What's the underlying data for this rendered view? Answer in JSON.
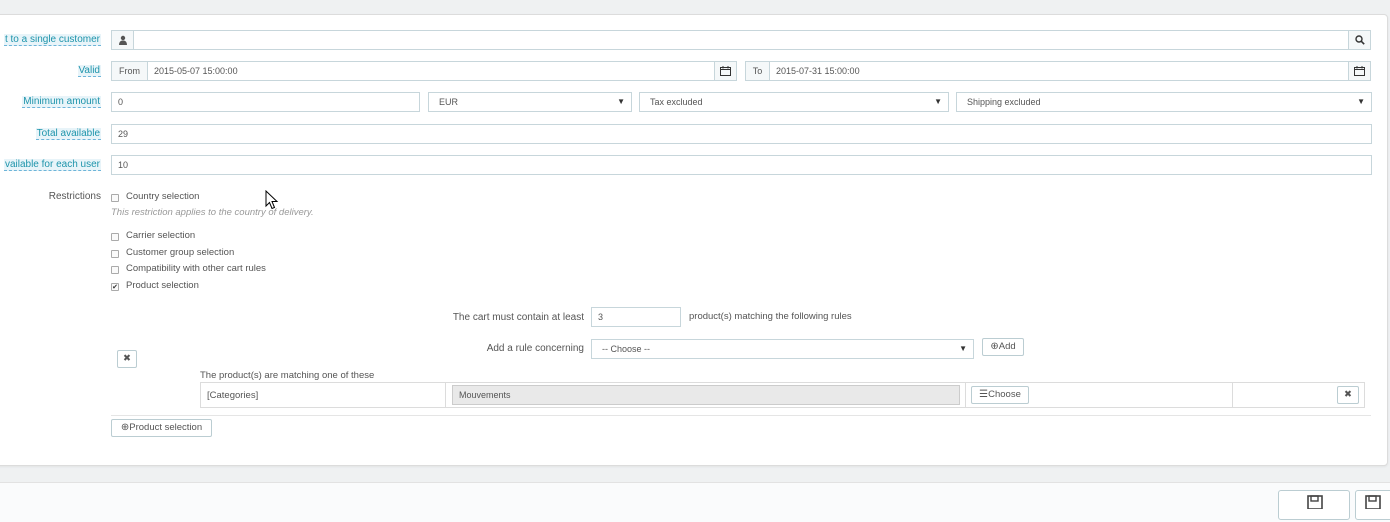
{
  "form": {
    "single_customer": {
      "label": "t to a single customer",
      "value": ""
    },
    "valid": {
      "label": "Valid",
      "from_label": "From",
      "from_value": "2015-05-07 15:00:00",
      "to_label": "To",
      "to_value": "2015-07-31 15:00:00"
    },
    "minimum_amount": {
      "label": "Minimum amount",
      "value": "0",
      "currency": "EUR",
      "tax": "Tax excluded",
      "shipping": "Shipping excluded"
    },
    "total_available": {
      "label": "Total available",
      "value": "29"
    },
    "available_each_user": {
      "label": "vailable for each user",
      "value": "10"
    },
    "restrictions": {
      "label": "Restrictions",
      "country": {
        "label": "Country selection",
        "checked": false,
        "hint": "This restriction applies to the country of delivery."
      },
      "carrier": {
        "label": "Carrier selection",
        "checked": false
      },
      "customer_group": {
        "label": "Customer group selection",
        "checked": false
      },
      "compatibility": {
        "label": "Compatibility with other cart rules",
        "checked": false
      },
      "product": {
        "label": "Product selection",
        "checked": true,
        "check_glyph": "✔"
      }
    },
    "product_rules": {
      "cart_min_label": "The cart must contain at least",
      "cart_min_value": "3",
      "cart_min_suffix": "product(s) matching the following rules",
      "rule_concerning_label": "Add a rule concerning",
      "rule_concerning_value": "-- Choose --",
      "add_button": "Add",
      "remove_group_glyph": "✖",
      "matching_label": "The product(s) are matching one of these",
      "rule_row": {
        "type": "[Categories]",
        "value": "Mouvements",
        "choose_button": "Choose",
        "remove_glyph": "✖"
      },
      "product_selection_button": "Product selection"
    }
  },
  "icons": {
    "user": "user-icon",
    "search": "search-icon",
    "calendar": "calendar-icon",
    "plus_circle": "plus-circle-icon",
    "list": "list-icon",
    "save": "save-icon"
  }
}
